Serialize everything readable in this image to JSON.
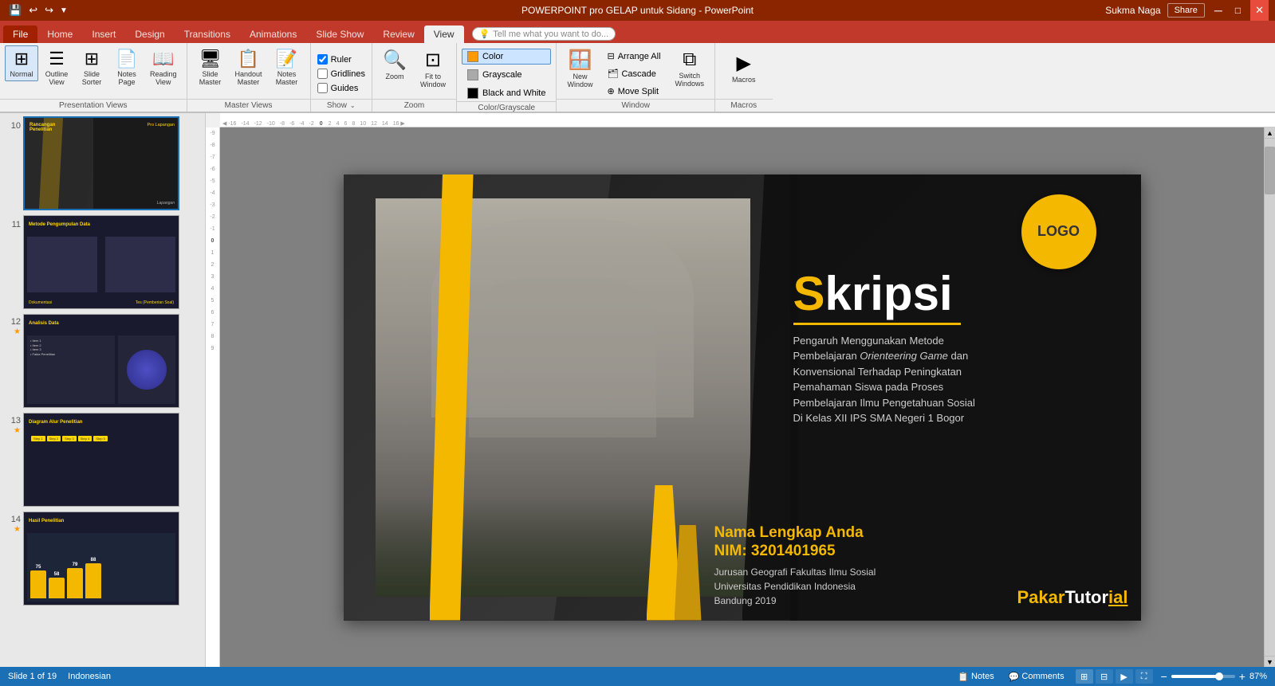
{
  "app": {
    "title": "POWERPOINT pro GELAP untuk Sidang - PowerPoint",
    "user": "Sukma Naga",
    "share_label": "Share"
  },
  "quick_access": {
    "save": "💾",
    "undo": "↩",
    "redo": "↪",
    "more": "▼"
  },
  "ribbon": {
    "tabs": [
      "File",
      "Home",
      "Insert",
      "Design",
      "Transitions",
      "Animations",
      "Slide Show",
      "Review",
      "View"
    ],
    "active_tab": "View",
    "tell_me_placeholder": "Tell me what you want to do...",
    "groups": {
      "presentation_views": {
        "label": "Presentation Views",
        "buttons": [
          {
            "id": "normal",
            "label": "Normal",
            "icon": "⊞"
          },
          {
            "id": "outline-view",
            "label": "Outline\nView",
            "icon": "☰"
          },
          {
            "id": "slide-sorter",
            "label": "Slide\nSorter",
            "icon": "⋮⋮"
          },
          {
            "id": "notes-page",
            "label": "Notes\nPage",
            "icon": "📄"
          },
          {
            "id": "reading-view",
            "label": "Reading\nView",
            "icon": "📖"
          }
        ]
      },
      "master_views": {
        "label": "Master Views",
        "buttons": [
          {
            "id": "slide-master",
            "label": "Slide\nMaster",
            "icon": "🖥"
          },
          {
            "id": "handout-master",
            "label": "Handout\nMaster",
            "icon": "📋"
          },
          {
            "id": "notes-master",
            "label": "Notes\nMaster",
            "icon": "📝"
          }
        ]
      },
      "show": {
        "label": "Show",
        "checkboxes": [
          {
            "id": "ruler",
            "label": "Ruler",
            "checked": true
          },
          {
            "id": "gridlines",
            "label": "Gridlines",
            "checked": false
          },
          {
            "id": "guides",
            "label": "Guides",
            "checked": false
          }
        ]
      },
      "zoom": {
        "label": "Zoom",
        "buttons": [
          {
            "id": "zoom",
            "label": "Zoom",
            "icon": "🔍"
          },
          {
            "id": "fit-to-window",
            "label": "Fit to\nWindow",
            "icon": "⊡"
          }
        ]
      },
      "color_grayscale": {
        "label": "Color/Grayscale",
        "options": [
          {
            "id": "color",
            "label": "Color",
            "swatch": "#ff9900",
            "active": true
          },
          {
            "id": "grayscale",
            "label": "Grayscale",
            "swatch": "#aaaaaa"
          },
          {
            "id": "black-white",
            "label": "Black and White",
            "swatch": "#000000"
          }
        ]
      },
      "window": {
        "label": "Window",
        "new_window": {
          "label": "New\nWindow",
          "icon": "🪟"
        },
        "arrange_all": {
          "label": "Arrange All"
        },
        "cascade": {
          "label": "Cascade"
        },
        "move_split": {
          "label": "Move Split"
        },
        "switch_windows": {
          "label": "Switch\nWindows"
        }
      },
      "macros": {
        "label": "Macros",
        "button": {
          "label": "Macros",
          "icon": "▶"
        }
      }
    }
  },
  "slides": [
    {
      "num": "10",
      "star": "",
      "title": "Rancangan Penelitian",
      "subtitle": "Pro Lapangan"
    },
    {
      "num": "11",
      "star": "",
      "title": "Metode Pengumpulan Data",
      "subtitle": ""
    },
    {
      "num": "12",
      "star": "★",
      "title": "Analisis Data",
      "subtitle": ""
    },
    {
      "num": "13",
      "star": "★",
      "title": "Diagram Alur Penelitian",
      "subtitle": ""
    },
    {
      "num": "14",
      "star": "★",
      "title": "Hasil Penelitian",
      "subtitle": ""
    }
  ],
  "main_slide": {
    "logo_text": "LOGO",
    "title_prefix": "S",
    "title_rest": "kripsi",
    "subtitle_line1": "Pengaruh Menggunakan Metode",
    "subtitle_line2": "Pembelajaran ",
    "subtitle_italic": "Orienteering Game",
    "subtitle_line2b": " dan",
    "subtitle_line3": "Konvensional Terhadap Peningkatan",
    "subtitle_line4": "Pemahaman Siswa pada Proses",
    "subtitle_line5": "Pembelajaran Ilmu Pengetahuan Sosial",
    "subtitle_line6": "Di Kelas XII IPS SMA Negeri 1 Bogor",
    "name_label": "Nama Lengkap Anda",
    "nim_label": "NIM: 3201401965",
    "institution_line1": "Jurusan Geografi  Fakultas Ilmu Sosial",
    "institution_line2": "Universitas Pendidikan Indonesia",
    "institution_line3": "Bandung 2019",
    "watermark_1": "Pakar",
    "watermark_2": "Tutor",
    "watermark_3": "ial"
  },
  "status_bar": {
    "slide_info": "Slide 1 of 19",
    "language": "Indonesian",
    "notes_label": "Notes",
    "comments_label": "Comments",
    "zoom_percent": "87%",
    "zoom_value": 87
  }
}
